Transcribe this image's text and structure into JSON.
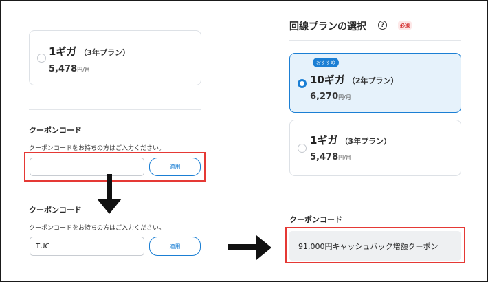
{
  "left_panel": {
    "plan": {
      "name": "1ギガ",
      "term": "（3年プラン）",
      "price": "5,478",
      "unit": "円/月"
    },
    "coupon_before": {
      "heading": "クーポンコード",
      "helper": "クーポンコードをお持ちの方はご入力ください。",
      "input_value": "",
      "apply_label": "適用"
    },
    "coupon_after": {
      "heading": "クーポンコード",
      "helper": "クーポンコードをお持ちの方はご入力ください。",
      "input_value": "TUC",
      "apply_label": "適用"
    }
  },
  "right_panel": {
    "section_title": "回線プランの選択",
    "help_symbol": "?",
    "required_label": "必須",
    "plans": [
      {
        "badge": "おすすめ",
        "name": "10ギガ",
        "term": "（2年プラン）",
        "price": "6,270",
        "unit": "円/月",
        "selected": true
      },
      {
        "name": "1ギガ",
        "term": "（3年プラン）",
        "price": "5,478",
        "unit": "円/月",
        "selected": false
      }
    ],
    "coupon": {
      "heading": "クーポンコード",
      "applied_text": "91,000円キャッシュバック増額クーポン"
    }
  },
  "colors": {
    "accent": "#1b7fd4",
    "highlight": "#e53935",
    "selected_bg": "#e6f2fb"
  },
  "icons": [
    "radio-button",
    "arrow-down-icon",
    "arrow-right-icon",
    "question-circle-icon"
  ]
}
